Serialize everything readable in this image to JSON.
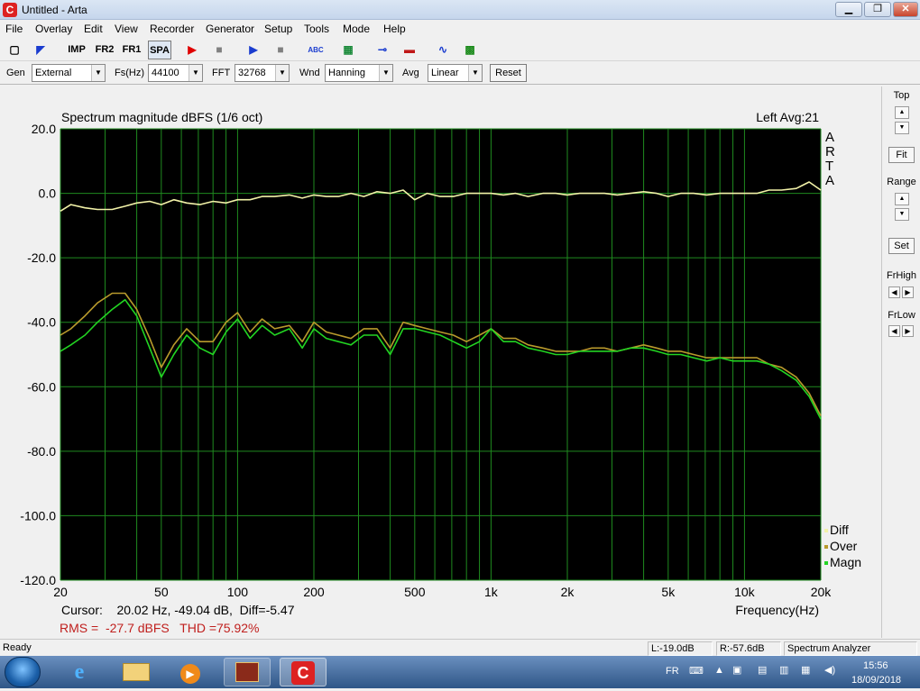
{
  "window": {
    "title": "Untitled - Arta",
    "app_icon": "C",
    "minimize": "▁",
    "maximize": "❐",
    "close": "✕"
  },
  "menu": [
    "File",
    "Overlay",
    "Edit",
    "View",
    "Recorder",
    "Generator",
    "Setup",
    "Tools",
    "Mode",
    "Help"
  ],
  "toolbar": {
    "buttons": [
      {
        "name": "new-icon",
        "glyph": "▢"
      },
      {
        "name": "open-icon",
        "glyph": "◤"
      },
      {
        "name": "imp-button",
        "glyph": "IMP"
      },
      {
        "name": "fr2-button",
        "glyph": "FR2"
      },
      {
        "name": "fr1-button",
        "glyph": "FR1"
      },
      {
        "name": "spa-button",
        "glyph": "SPA"
      },
      {
        "name": "record-icon",
        "glyph": "▶"
      },
      {
        "name": "stop-icon",
        "glyph": "■"
      },
      {
        "name": "play-icon",
        "glyph": "▶"
      },
      {
        "name": "stop2-icon",
        "glyph": "■"
      },
      {
        "name": "abc-icon",
        "glyph": "ABC"
      },
      {
        "name": "pattern-icon",
        "glyph": "▦"
      },
      {
        "name": "probe-icon",
        "glyph": "⊸"
      },
      {
        "name": "flag-icon",
        "glyph": "▬"
      },
      {
        "name": "wave-icon",
        "glyph": "∿"
      },
      {
        "name": "scope-icon",
        "glyph": "▩"
      }
    ],
    "colors": {
      "record": "#e00000",
      "play": "#1a3ccf",
      "stop": "#808080"
    }
  },
  "controls": {
    "gen_label": "Gen",
    "gen_value": "External",
    "fs_label": "Fs(Hz)",
    "fs_value": "44100",
    "fft_label": "FFT",
    "fft_value": "32768",
    "wnd_label": "Wnd",
    "wnd_value": "Hanning",
    "avg_label": "Avg",
    "avg_value": "Linear",
    "reset_label": "Reset"
  },
  "right_panel": {
    "top": "Top",
    "fit": "Fit",
    "range": "Range",
    "set": "Set",
    "frhigh": "FrHigh",
    "frlow": "FrLow",
    "up": "▲",
    "down": "▼",
    "left": "◀",
    "right": "▶"
  },
  "plot": {
    "cursor_text": "Cursor:    20.02 Hz, -49.04 dB,  Diff=-5.47",
    "rms_text": "RMS =  -27.7 dBFS   THD =75.92%",
    "channel_text": "Left  Avg:21",
    "watermark": [
      "A",
      "R",
      "T",
      "A"
    ]
  },
  "chart_data": {
    "type": "line",
    "title": "Spectrum magnitude dBFS (1/6 oct)",
    "xlabel": "Frequency(Hz)",
    "ylabel": "",
    "x_scale": "log",
    "xlim": [
      20,
      20000
    ],
    "ylim": [
      -120,
      20
    ],
    "x_ticks": [
      {
        "value": 20,
        "label": "20"
      },
      {
        "value": 50,
        "label": "50"
      },
      {
        "value": 100,
        "label": "100"
      },
      {
        "value": 200,
        "label": "200"
      },
      {
        "value": 500,
        "label": "500"
      },
      {
        "value": 1000,
        "label": "1k"
      },
      {
        "value": 2000,
        "label": "2k"
      },
      {
        "value": 5000,
        "label": "5k"
      },
      {
        "value": 10000,
        "label": "10k"
      },
      {
        "value": 20000,
        "label": "20k"
      }
    ],
    "y_ticks": [
      {
        "value": 20,
        "label": "20.0"
      },
      {
        "value": 0,
        "label": "0.0"
      },
      {
        "value": -20,
        "label": "-20.0"
      },
      {
        "value": -40,
        "label": "-40.0"
      },
      {
        "value": -60,
        "label": "-60.0"
      },
      {
        "value": -80,
        "label": "-80.0"
      },
      {
        "value": -100,
        "label": "-100.0"
      },
      {
        "value": -120,
        "label": "-120.0"
      }
    ],
    "grid": true,
    "legend_position": "bottom-right",
    "background": "#000000",
    "grid_color": "#1f8a1f",
    "series": [
      {
        "name": "Diff",
        "color": "#f2f2a8",
        "x": [
          20,
          22,
          25,
          28,
          32,
          36,
          40,
          45,
          50,
          56,
          63,
          71,
          80,
          90,
          100,
          112,
          125,
          140,
          160,
          180,
          200,
          224,
          250,
          280,
          315,
          355,
          400,
          450,
          500,
          560,
          630,
          710,
          800,
          900,
          1000,
          1120,
          1250,
          1400,
          1600,
          1800,
          2000,
          2240,
          2500,
          2800,
          3150,
          3550,
          4000,
          4500,
          5000,
          5600,
          6300,
          7100,
          8000,
          9000,
          10000,
          11200,
          12500,
          14000,
          16000,
          18000,
          20000
        ],
        "y": [
          -5.5,
          -3.5,
          -4.5,
          -5,
          -5,
          -4,
          -3,
          -2.5,
          -3.5,
          -2,
          -3,
          -3.5,
          -2.5,
          -3,
          -2,
          -2,
          -1,
          -1,
          -0.5,
          -1.5,
          -0.5,
          -1,
          -1,
          0,
          -1,
          0.5,
          0,
          1,
          -2,
          0,
          -1,
          -1,
          0,
          0,
          0,
          -0.5,
          0,
          -1,
          0,
          0,
          -0.5,
          0,
          0,
          0,
          -0.5,
          0,
          0.5,
          0,
          -1,
          0,
          0,
          -0.5,
          0,
          0,
          0,
          0,
          1,
          1,
          1.5,
          3.5,
          1
        ]
      },
      {
        "name": "Over",
        "color": "#b89a2c",
        "x": [
          20,
          22,
          25,
          28,
          32,
          36,
          40,
          45,
          50,
          56,
          63,
          71,
          80,
          90,
          100,
          112,
          125,
          140,
          160,
          180,
          200,
          224,
          250,
          280,
          315,
          355,
          400,
          450,
          500,
          560,
          630,
          710,
          800,
          900,
          1000,
          1120,
          1250,
          1400,
          1600,
          1800,
          2000,
          2240,
          2500,
          2800,
          3150,
          3550,
          4000,
          4500,
          5000,
          5600,
          6300,
          7100,
          8000,
          9000,
          10000,
          11200,
          12500,
          14000,
          16000,
          18000,
          20000
        ],
        "y": [
          -44,
          -42,
          -38,
          -34,
          -31,
          -31,
          -36,
          -45,
          -54,
          -47,
          -42,
          -46,
          -46,
          -40,
          -37,
          -43,
          -39,
          -42,
          -41,
          -46,
          -40,
          -43,
          -44,
          -45,
          -42,
          -42,
          -48,
          -40,
          -41,
          -42,
          -43,
          -44,
          -46,
          -44,
          -42,
          -45,
          -45,
          -47,
          -48,
          -49,
          -49,
          -49,
          -48,
          -48,
          -49,
          -48,
          -47,
          -48,
          -49,
          -49,
          -50,
          -51,
          -51,
          -51,
          -51,
          -51,
          -53,
          -54,
          -57,
          -62,
          -69
        ]
      },
      {
        "name": "Magn",
        "color": "#22d422",
        "x": [
          20,
          22,
          25,
          28,
          32,
          36,
          40,
          45,
          50,
          56,
          63,
          71,
          80,
          90,
          100,
          112,
          125,
          140,
          160,
          180,
          200,
          224,
          250,
          280,
          315,
          355,
          400,
          450,
          500,
          560,
          630,
          710,
          800,
          900,
          1000,
          1120,
          1250,
          1400,
          1600,
          1800,
          2000,
          2240,
          2500,
          2800,
          3150,
          3550,
          4000,
          4500,
          5000,
          5600,
          6300,
          7100,
          8000,
          9000,
          10000,
          11200,
          12500,
          14000,
          16000,
          18000,
          20000
        ],
        "y": [
          -49,
          -47,
          -44,
          -40,
          -36,
          -33,
          -38,
          -48,
          -57,
          -50,
          -44,
          -48,
          -50,
          -43,
          -39,
          -45,
          -41,
          -44,
          -42,
          -48,
          -42,
          -45,
          -46,
          -47,
          -44,
          -44,
          -50,
          -42,
          -42,
          -43,
          -44,
          -46,
          -48,
          -46,
          -42,
          -46,
          -46,
          -48,
          -49,
          -50,
          -50,
          -49,
          -49,
          -49,
          -49,
          -48,
          -48,
          -49,
          -50,
          -50,
          -51,
          -52,
          -51,
          -52,
          -52,
          -52,
          -53,
          -55,
          -58,
          -63,
          -70
        ]
      }
    ]
  },
  "status": {
    "ready": "Ready",
    "l_level": "L:-19.0dB",
    "r_level": "R:-57.6dB",
    "mode": "Spectrum Analyzer"
  },
  "taskbar": {
    "lang": "FR",
    "time": "15:56",
    "date": "18/09/2018"
  }
}
